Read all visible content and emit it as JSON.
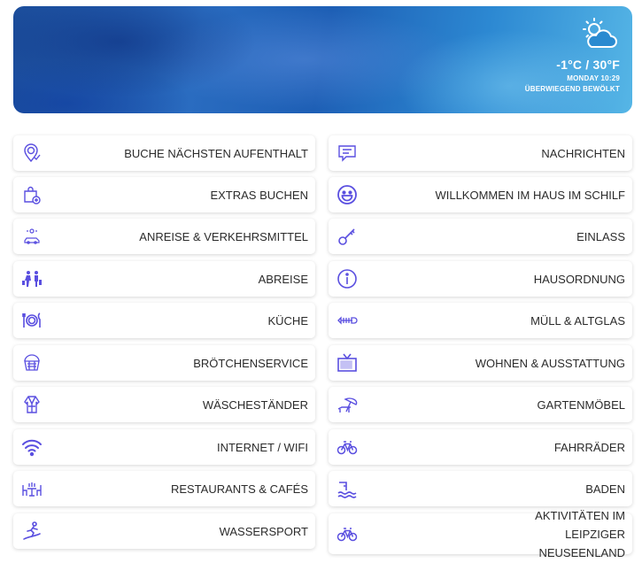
{
  "weather": {
    "temperature": "-1°C / 30°F",
    "day_time": "MONDAY 10:29",
    "condition": "ÜBERWIEGEND BEWÖLKT",
    "icon": "partly-cloudy-icon"
  },
  "colors": {
    "icon": "#5a4fe0",
    "text": "#2b2b2b"
  },
  "left_items": [
    {
      "label": "BUCHE NÄCHSTEN AUFENTHALT",
      "icon": "location-check-icon"
    },
    {
      "label": "EXTRAS BUCHEN",
      "icon": "shopping-bag-plus-icon"
    },
    {
      "label": "ANREISE & VERKEHRSMITTEL",
      "icon": "car-location-icon"
    },
    {
      "label": "ABREISE",
      "icon": "travelers-icon"
    },
    {
      "label": "KÜCHE",
      "icon": "plate-cutlery-icon"
    },
    {
      "label": "BRÖTCHENSERVICE",
      "icon": "bread-basket-icon"
    },
    {
      "label": "WÄSCHESTÄNDER",
      "icon": "bathrobe-icon"
    },
    {
      "label": "INTERNET / WIFI",
      "icon": "wifi-icon"
    },
    {
      "label": "RESTAURANTS & CAFÉS",
      "icon": "dining-table-icon"
    },
    {
      "label": "WASSERSPORT",
      "icon": "surfer-icon"
    }
  ],
  "right_items": [
    {
      "label": "NACHRICHTEN",
      "icon": "message-icon"
    },
    {
      "label": "WILLKOMMEN IM HAUS IM SCHILF",
      "icon": "smiley-icon"
    },
    {
      "label": "EINLASS",
      "icon": "key-icon"
    },
    {
      "label": "HAUSORDNUNG",
      "icon": "info-icon"
    },
    {
      "label": "MÜLL & ALTGLAS",
      "icon": "fish-bone-icon"
    },
    {
      "label": "WOHNEN & AUSSTATTUNG",
      "icon": "tv-icon"
    },
    {
      "label": "GARTENMÖBEL",
      "icon": "sunbed-umbrella-icon"
    },
    {
      "label": "FAHRRÄDER",
      "icon": "bicycle-icon"
    },
    {
      "label": "BADEN",
      "icon": "swimming-ladder-icon"
    },
    {
      "label": "AKTIVITÄTEN IM LEIPZIGER NEUSEENLAND",
      "icon": "bicycle-icon"
    }
  ]
}
